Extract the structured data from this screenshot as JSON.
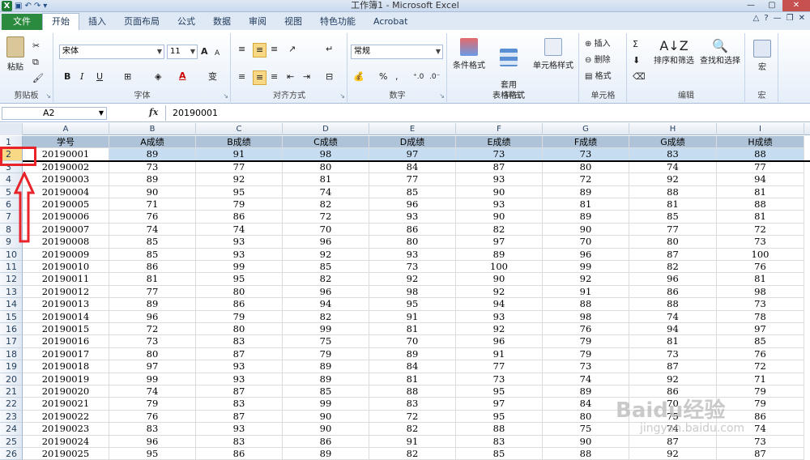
{
  "window": {
    "title": "工作簿1 - Microsoft Excel"
  },
  "tabs": [
    "文件",
    "开始",
    "插入",
    "页面布局",
    "公式",
    "数据",
    "审阅",
    "视图",
    "特色功能",
    "Acrobat"
  ],
  "ribbon": {
    "clipboard": {
      "label": "剪贴板",
      "paste": "粘贴"
    },
    "font": {
      "label": "字体",
      "name": "宋体",
      "size": "11",
      "bold": "B",
      "italic": "I",
      "underline": "U",
      "grow": "A",
      "shrink": "A",
      "phonetic": "变"
    },
    "alignment": {
      "label": "对齐方式"
    },
    "number": {
      "label": "数字",
      "format": "常规",
      "percent": "%",
      "comma": ","
    },
    "styles": {
      "label": "样式",
      "conditional": "条件格式",
      "table": "套用\n表格格式",
      "cell": "单元格样式"
    },
    "cells": {
      "label": "单元格",
      "insert": "插入",
      "delete": "删除",
      "format": "格式"
    },
    "editing": {
      "label": "编辑",
      "sort": "排序和筛选",
      "find": "查找和选择"
    },
    "macro": {
      "label": "宏",
      "btn": "宏"
    }
  },
  "formula": {
    "namebox": "A2",
    "fx": "fx",
    "value": "20190001"
  },
  "columns": [
    "A",
    "B",
    "C",
    "D",
    "E",
    "F",
    "G",
    "H",
    "I"
  ],
  "sheet": {
    "headers": [
      "学号",
      "A成绩",
      "B成绩",
      "C成绩",
      "D成绩",
      "E成绩",
      "F成绩",
      "G成绩",
      "H成绩"
    ],
    "rows": [
      [
        "20190001",
        "89",
        "91",
        "98",
        "97",
        "73",
        "73",
        "83",
        "88"
      ],
      [
        "20190002",
        "73",
        "77",
        "80",
        "84",
        "87",
        "80",
        "74",
        "77"
      ],
      [
        "20190003",
        "89",
        "92",
        "81",
        "77",
        "93",
        "72",
        "92",
        "94"
      ],
      [
        "20190004",
        "90",
        "95",
        "74",
        "85",
        "90",
        "89",
        "88",
        "81"
      ],
      [
        "20190005",
        "71",
        "79",
        "82",
        "96",
        "93",
        "81",
        "81",
        "88"
      ],
      [
        "20190006",
        "76",
        "86",
        "72",
        "93",
        "90",
        "89",
        "85",
        "81"
      ],
      [
        "20190007",
        "74",
        "74",
        "70",
        "86",
        "82",
        "90",
        "77",
        "72"
      ],
      [
        "20190008",
        "85",
        "93",
        "96",
        "80",
        "97",
        "70",
        "80",
        "73"
      ],
      [
        "20190009",
        "85",
        "93",
        "92",
        "93",
        "89",
        "96",
        "87",
        "100"
      ],
      [
        "20190010",
        "86",
        "99",
        "85",
        "73",
        "100",
        "99",
        "82",
        "76"
      ],
      [
        "20190011",
        "81",
        "95",
        "82",
        "92",
        "90",
        "92",
        "96",
        "81"
      ],
      [
        "20190012",
        "77",
        "80",
        "96",
        "98",
        "92",
        "91",
        "86",
        "98"
      ],
      [
        "20190013",
        "89",
        "86",
        "94",
        "95",
        "94",
        "88",
        "88",
        "73"
      ],
      [
        "20190014",
        "96",
        "79",
        "82",
        "91",
        "93",
        "98",
        "74",
        "78"
      ],
      [
        "20190015",
        "72",
        "80",
        "99",
        "81",
        "92",
        "76",
        "94",
        "97"
      ],
      [
        "20190016",
        "73",
        "83",
        "75",
        "70",
        "96",
        "79",
        "81",
        "85"
      ],
      [
        "20190017",
        "80",
        "87",
        "79",
        "89",
        "91",
        "79",
        "73",
        "76"
      ],
      [
        "20190018",
        "97",
        "93",
        "89",
        "84",
        "77",
        "73",
        "87",
        "72"
      ],
      [
        "20190019",
        "99",
        "93",
        "89",
        "81",
        "73",
        "74",
        "92",
        "71"
      ],
      [
        "20190020",
        "74",
        "87",
        "85",
        "88",
        "95",
        "89",
        "86",
        "79"
      ],
      [
        "20190021",
        "79",
        "83",
        "99",
        "83",
        "97",
        "84",
        "70",
        "79"
      ],
      [
        "20190022",
        "76",
        "87",
        "90",
        "72",
        "95",
        "80",
        "75",
        "86"
      ],
      [
        "20190023",
        "83",
        "93",
        "90",
        "82",
        "88",
        "75",
        "74",
        "74"
      ],
      [
        "20190024",
        "96",
        "83",
        "86",
        "91",
        "83",
        "90",
        "87",
        "73"
      ],
      [
        "20190025",
        "95",
        "86",
        "89",
        "82",
        "85",
        "88",
        "92",
        "87"
      ]
    ]
  },
  "watermark": {
    "brand": "Baidu经验",
    "url": "jingyan.baidu.com"
  },
  "colors": {
    "header_fill": "#aec3d7",
    "selection": "#c5dcf1",
    "annotation": "#e8232a",
    "file_tab": "#2a8a3e"
  }
}
